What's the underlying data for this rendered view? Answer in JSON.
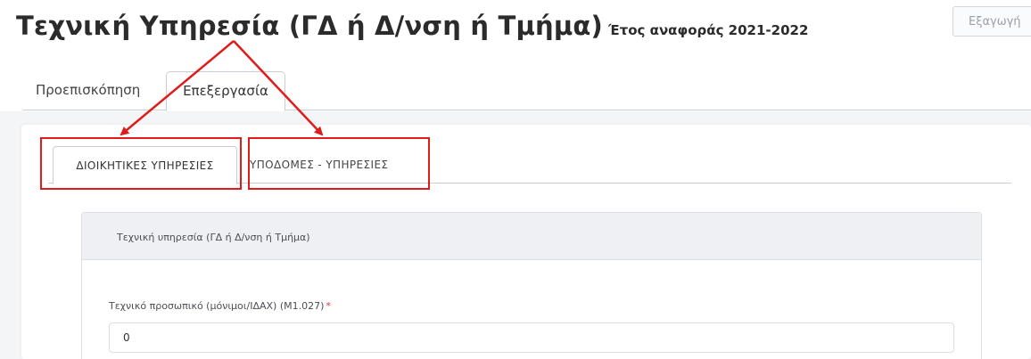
{
  "page": {
    "title": "Τεχνική Υπηρεσία (ΓΔ ή Δ/νση ή Τμήμα)",
    "subtitle": "Έτος αναφοράς 2021-2022",
    "export_label": "Εξαγωγή"
  },
  "top_tabs": [
    {
      "label": "Προεπισκόπηση",
      "active": false
    },
    {
      "label": "Επεξεργασία",
      "active": true
    }
  ],
  "inner_tabs": [
    {
      "label": "ΔΙΟΙΚΗΤΙΚΕΣ ΥΠΗΡΕΣΙΕΣ",
      "active": true
    },
    {
      "label": "ΥΠΟΔΟΜΕΣ - ΥΠΗΡΕΣΙΕΣ",
      "active": false
    }
  ],
  "section": {
    "header": "Τεχνική υπηρεσία (ΓΔ ή Δ/νση ή Τμήμα)",
    "field_label": "Τεχνικό προσωπικό (μόνιμοι/ΙΔΑΧ) (Μ1.027)",
    "required_mark": "*",
    "field_value": "0"
  },
  "colors": {
    "annotation": "#e01b1b",
    "required": "#e03a3a"
  }
}
